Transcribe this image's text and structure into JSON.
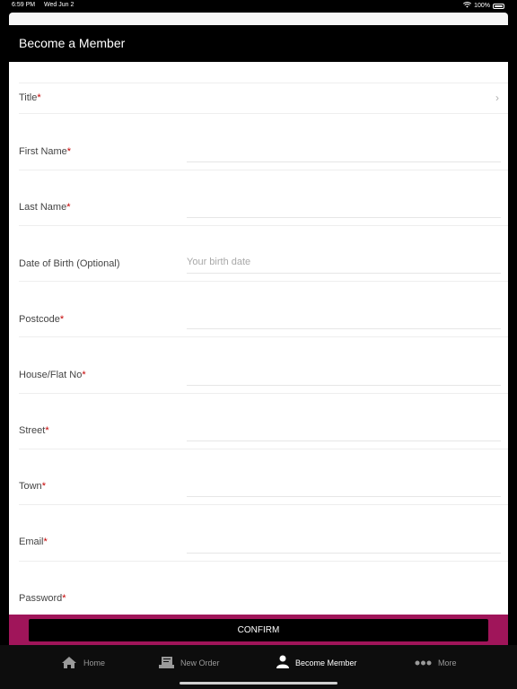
{
  "status_bar": {
    "time": "6:59 PM",
    "date": "Wed Jun 2",
    "battery": "100%"
  },
  "header": {
    "title": "Become a Member"
  },
  "form": {
    "fields": [
      {
        "label": "Title",
        "required": true,
        "placeholder": "",
        "type": "select"
      },
      {
        "label": "First Name",
        "required": true,
        "placeholder": ""
      },
      {
        "label": "Last Name",
        "required": true,
        "placeholder": ""
      },
      {
        "label": "Date of Birth (Optional)",
        "required": false,
        "placeholder": "Your birth date"
      },
      {
        "label": "Postcode",
        "required": true,
        "placeholder": ""
      },
      {
        "label": "House/Flat No",
        "required": true,
        "placeholder": ""
      },
      {
        "label": "Street",
        "required": true,
        "placeholder": ""
      },
      {
        "label": "Town",
        "required": true,
        "placeholder": ""
      },
      {
        "label": "Email",
        "required": true,
        "placeholder": ""
      },
      {
        "label": "Password",
        "required": true,
        "placeholder": ""
      }
    ],
    "required_mark": "*"
  },
  "confirm": {
    "label": "CONFIRM"
  },
  "tabs": [
    {
      "label": "Home",
      "icon": "home-icon",
      "active": false
    },
    {
      "label": "New Order",
      "icon": "new-order-icon",
      "active": false
    },
    {
      "label": "Become Member",
      "icon": "member-icon",
      "active": true
    },
    {
      "label": "More",
      "icon": "more-dots-icon",
      "active": false
    }
  ],
  "colors": {
    "accent": "#a0155a",
    "required": "#c40000",
    "header": "#000000"
  }
}
